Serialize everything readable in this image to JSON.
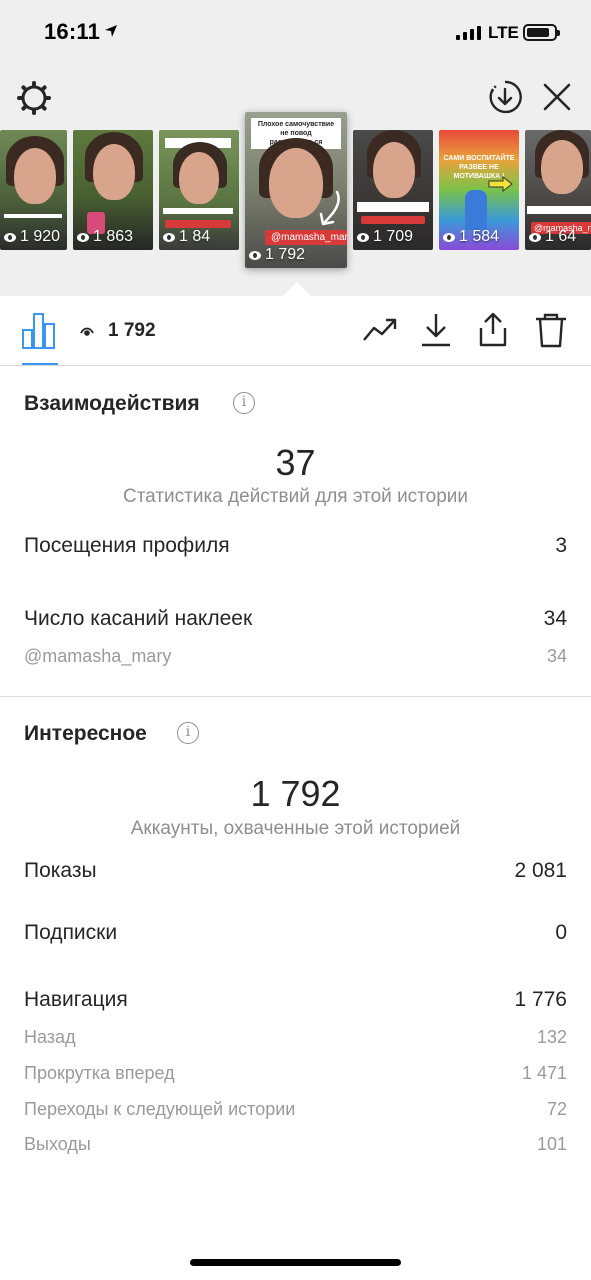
{
  "status_bar": {
    "time": "16:11",
    "network": "LTE"
  },
  "stories": [
    {
      "views": "1 920",
      "tag": ""
    },
    {
      "views": "1 863",
      "tag": ""
    },
    {
      "views": "1 84",
      "tag": ""
    },
    {
      "views": "1 792",
      "tag": "@mamasha_mary",
      "caption": "Плохое самочувствие не повод расслабляться"
    },
    {
      "views": "1 709",
      "tag": ""
    },
    {
      "views": "1 584",
      "tag": "",
      "caption": "САМИ ВОСПИТАЙТЕ РАЗВЕЕ НЕ МОТИВАШКА !"
    },
    {
      "views": "1 64",
      "tag": "@mamasha_mary"
    }
  ],
  "toolbar": {
    "views_count": "1 792"
  },
  "interactions": {
    "title": "Взаимодействия",
    "total": "37",
    "total_caption": "Статистика действий для этой истории",
    "rows": [
      {
        "label": "Посещения профиля",
        "value": "3"
      },
      {
        "label": "Число касаний наклеек",
        "value": "34"
      },
      {
        "label": "@mamasha_mary",
        "value": "34"
      }
    ]
  },
  "discovery": {
    "title": "Интересное",
    "total": "1 792",
    "total_caption": "Аккаунты, охваченные этой историей",
    "rows": [
      {
        "label": "Показы",
        "value": "2 081"
      },
      {
        "label": "Подписки",
        "value": "0"
      },
      {
        "label": "Навигация",
        "value": "1 776"
      },
      {
        "label": "Назад",
        "value": "132"
      },
      {
        "label": "Прокрутка вперед",
        "value": "1 471"
      },
      {
        "label": "Переходы к следующей истории",
        "value": "72"
      },
      {
        "label": "Выходы",
        "value": "101"
      }
    ]
  },
  "colors": {
    "accent": "#3897f0",
    "muted": "#8e8e8e",
    "tag_red": "#d83a3a"
  }
}
